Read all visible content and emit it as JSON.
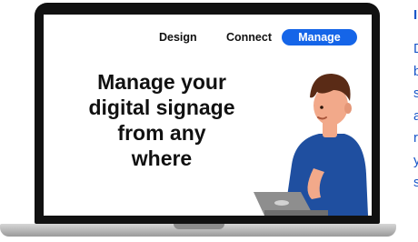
{
  "nav": {
    "design_label": "Design",
    "connect_label": "Connect",
    "manage_label": "Manage"
  },
  "headline": {
    "line1": "Manage your",
    "line2": "digital signage",
    "line3": "from any",
    "line4": "where"
  },
  "side": {
    "title": "I",
    "lines": [
      "D",
      "b",
      "s",
      "a",
      "r",
      "y",
      "s"
    ]
  },
  "colors": {
    "accent": "#1565e8",
    "side_text": "#1a56c8",
    "shirt": "#1f4fa0",
    "hair": "#5a2b16",
    "skin": "#f2a98a",
    "laptop_gray": "#8e8e8e"
  }
}
